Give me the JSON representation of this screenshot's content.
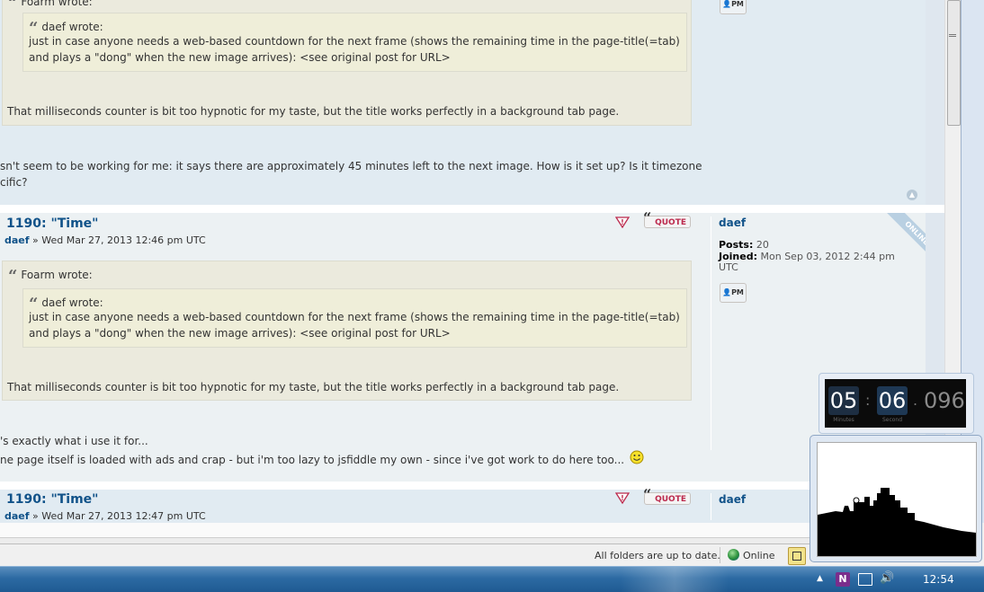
{
  "posts": [
    {
      "quote_author_outer": "Foarm wrote:",
      "quote_author_inner": "daef wrote:",
      "inner_quote_text": "just in case anyone needs a web-based countdown for the next frame (shows the remaining time in the page-title(=tab) and plays a \"dong\" when the new image arrives): <see original post for URL>",
      "outer_quote_text": "That milliseconds counter is bit too hypnotic for my taste, but the title works perfectly in a background tab page.",
      "body_lines": [
        "sn't seem to be working for me: it says there are approximately 45 minutes left to the next image. How is it set up? Is it timezone",
        "cific?"
      ],
      "pm_label": "PM"
    },
    {
      "title": "1190: \"Time\"",
      "author": "daef",
      "date": "» Wed Mar 27, 2013 12:46 pm UTC",
      "quote_author_outer": "Foarm wrote:",
      "quote_author_inner": "daef wrote:",
      "inner_quote_text": "just in case anyone needs a web-based countdown for the next frame (shows the remaining time in the page-title(=tab) and plays a \"dong\" when the new image arrives): <see original post for URL>",
      "outer_quote_text": "That milliseconds counter is bit too hypnotic for my taste, but the title works perfectly in a background tab page.",
      "body_lines": [
        "'s exactly what i use it for...",
        "ne page itself is loaded with ads and crap - but i'm too lazy to jsfiddle my own - since i've got work to do here too..."
      ],
      "quote_button": "QUOTE",
      "profile": {
        "username": "daef",
        "posts_label": "Posts:",
        "posts_value": "20",
        "joined_label": "Joined:",
        "joined_value": "Mon Sep 03, 2012 2:44 pm",
        "joined_tz": "UTC",
        "online_badge": "ONLINE"
      },
      "pm_label": "PM"
    },
    {
      "title": "1190: \"Time\"",
      "author": "daef",
      "date": "» Wed Mar 27, 2013 12:47 pm UTC",
      "quote_button": "QUOTE",
      "profile": {
        "username": "daef"
      }
    }
  ],
  "statusbar": {
    "sync_status": "All folders are up to date.",
    "connection": "Online"
  },
  "countdown": {
    "minutes": "05",
    "seconds": "06",
    "milliseconds": "096",
    "minutes_label": "Minutes",
    "seconds_label": "Second"
  },
  "taskbar": {
    "clock": "12:54",
    "onenote_icon": "N"
  },
  "icons": {
    "report": "report-icon",
    "quote": "quote-icon",
    "pm": "pm-icon",
    "top": "back-to-top-icon",
    "smiley": "smiley-icon",
    "globe": "globe-icon"
  }
}
